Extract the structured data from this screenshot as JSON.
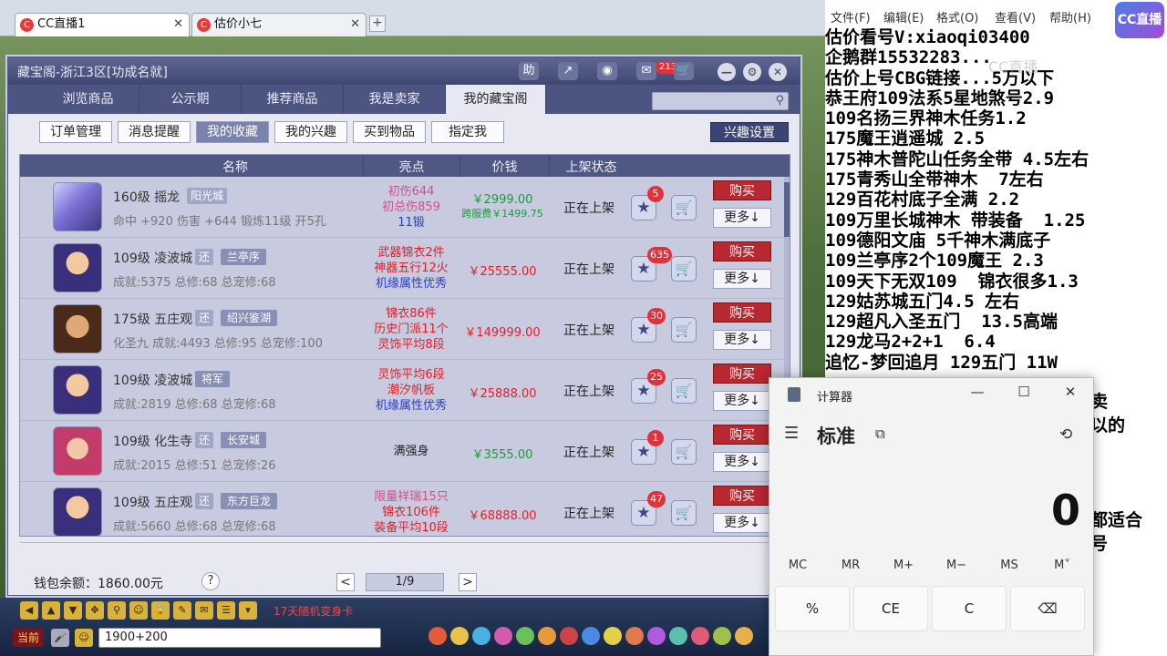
{
  "browser": {
    "tabs": [
      {
        "label": "CC直播1"
      },
      {
        "label": "估价小七"
      }
    ],
    "add_tab": "+",
    "close": "✕"
  },
  "cbg": {
    "title": "藏宝阁-浙江3区[功成名就]",
    "help_label": "助",
    "msg_count": "213",
    "nav_tabs": [
      "浏览商品",
      "公示期",
      "推荐商品",
      "我是卖家",
      "我的藏宝阁"
    ],
    "sub_tabs": [
      "订单管理",
      "消息提醒",
      "我的收藏",
      "我的兴趣",
      "买到物品",
      "指定我"
    ],
    "interest_settings": "兴趣设置",
    "headers": {
      "name": "名称",
      "highlight": "亮点",
      "price": "价钱",
      "status": "上架状态"
    },
    "rows": [
      {
        "name": "160级 摇龙",
        "tag1": "阳光城",
        "tag2": "",
        "stats": "命中 +920  伤害 +644  锻炼11级  开5孔",
        "hl": [
          "初伤644",
          "初总伤859",
          "11锻"
        ],
        "hl_colors": [
          "#d0508a",
          "#d0508a",
          "#2a40c8"
        ],
        "price": "￥2999.00",
        "price2": "跨服费￥1499.75",
        "price_color": "#1a9a3a",
        "status": "正在上架",
        "fav": "5",
        "buy": "购买",
        "more": "更多↓",
        "avatar": "sword"
      },
      {
        "name": "109级 凌波城",
        "tag1": "还",
        "tag2": "兰亭序",
        "stats": "成就:5375  总修:68  总宠修:68",
        "hl": [
          "武器锦衣2件",
          "神器五行12火",
          "机缘属性优秀"
        ],
        "hl_colors": [
          "#e0202a",
          "#e0202a",
          "#2a40c8"
        ],
        "price": "￥25555.00",
        "price2": "",
        "price_color": "#e0202a",
        "status": "正在上架",
        "fav": "635",
        "buy": "购买",
        "more": "更多↓",
        "avatar": "char1"
      },
      {
        "name": "175级 五庄观",
        "tag1": "还",
        "tag2": "绍兴鉴湖",
        "stats": "化圣九  成就:4493  总修:95  总宠修:100",
        "hl": [
          "锦衣86件",
          "历史门派11个",
          "灵饰平均8段"
        ],
        "hl_colors": [
          "#e0202a",
          "#e0202a",
          "#e0202a"
        ],
        "price": "￥149999.00",
        "price2": "",
        "price_color": "#e0202a",
        "status": "正在上架",
        "fav": "30",
        "buy": "购买",
        "more": "更多↓",
        "avatar": "char2"
      },
      {
        "name": "109级 凌波城",
        "tag1": "",
        "tag2": "将军",
        "stats": "成就:2819  总修:68  总宠修:68",
        "hl": [
          "灵饰平均6段",
          "潮汐帆板",
          "机缘属性优秀"
        ],
        "hl_colors": [
          "#e0202a",
          "#e0202a",
          "#2a40c8"
        ],
        "price": "￥25888.00",
        "price2": "",
        "price_color": "#e0202a",
        "status": "正在上架",
        "fav": "25",
        "buy": "购买",
        "more": "更多↓",
        "avatar": "char1"
      },
      {
        "name": "109级 化生寺",
        "tag1": "还",
        "tag2": "长安城",
        "stats": "成就:2015  总修:51  总宠修:26",
        "hl": [
          "",
          "满强身",
          ""
        ],
        "hl_colors": [
          "#222",
          "#222",
          "#222"
        ],
        "price": "￥3555.00",
        "price2": "",
        "price_color": "#1a9a3a",
        "status": "正在上架",
        "fav": "1",
        "buy": "购买",
        "more": "更多↓",
        "avatar": "char3"
      },
      {
        "name": "109级 五庄观",
        "tag1": "还",
        "tag2": "东方巨龙",
        "stats": "成就:5660  总修:68  总宠修:68",
        "hl": [
          "限量祥瑞15只",
          "锦衣106件",
          "装备平均10段"
        ],
        "hl_colors": [
          "#d0508a",
          "#e0202a",
          "#e0202a"
        ],
        "price": "￥68888.00",
        "price2": "",
        "price_color": "#e0202a",
        "status": "正在上架",
        "fav": "47",
        "buy": "购买",
        "more": "更多↓",
        "avatar": "char1"
      }
    ],
    "wallet": "钱包余额：1860.00元",
    "help_icon": "?",
    "page": "1/9",
    "prev": "<",
    "next": ">"
  },
  "game": {
    "input": "1900+200",
    "chat_tag": "当前",
    "notice": "17天随机变身卡"
  },
  "notepad": {
    "menu": [
      "文件(F)",
      "编辑(E)",
      "格式(O)",
      "查看(V)",
      "帮助(H)"
    ],
    "lines": [
      "估价看号V:xiaoqi03400",
      "企鹅群15532283...",
      "估价上号CBG链接...5万以下",
      "恭王府109法系5星地煞号2.9",
      "109名扬三界神木任务1.2",
      "175魔王逍遥城 2.5",
      "175神木普陀山任务全带 4.5左右",
      "175青秀山全带神木  7左右",
      "129百花村底子全满 2.2",
      "109万里长城神木 带装备  1.25",
      "109德阳文庙 5千神木满底子",
      "109兰亭序2个109魔王 2.3",
      "109天下无双109  锦衣很多1.3",
      "129姑苏城五门4.5 左右",
      "129超凡入圣五门  13.5高端",
      "129龙马2+2+1  6.4",
      "追忆-梦回追月 129五门 11W"
    ],
    "behind": [
      "卖",
      "以的",
      "",
      "",
      "",
      "都适合",
      "号"
    ]
  },
  "overlay": {
    "logo": "CC直播",
    "watermark": "CC直播"
  },
  "calc": {
    "title": "计算器",
    "mode": "标准",
    "display": "0",
    "menu_icon": "☰",
    "keep_icon": "⧉",
    "history_icon": "⟲",
    "min": "—",
    "max": "☐",
    "close": "✕",
    "memory": [
      "MC",
      "MR",
      "M+",
      "M−",
      "MS",
      "M˅"
    ],
    "keys": [
      "%",
      "CE",
      "C",
      "⌫"
    ]
  }
}
